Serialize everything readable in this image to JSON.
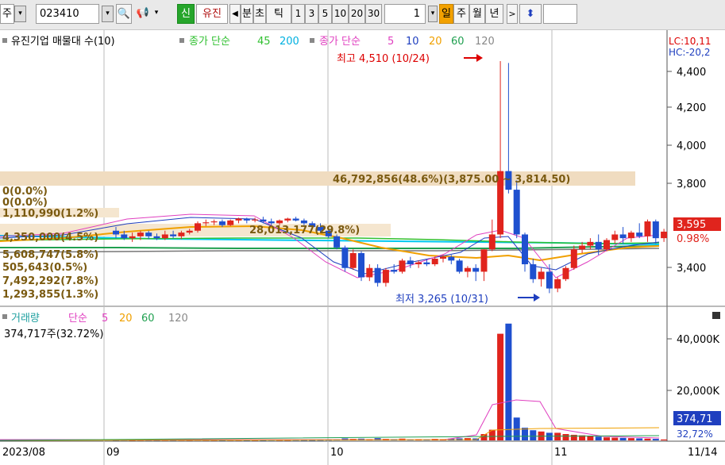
{
  "toolbar": {
    "market_label": "주",
    "code_value": "023410",
    "new_label": "신",
    "name_label": "유진",
    "period_buttons": [
      "분",
      "초",
      "틱"
    ],
    "intervals": [
      "1",
      "3",
      "5",
      "10",
      "20",
      "30"
    ],
    "interval_value": "1",
    "day_label": "일",
    "week_label": "주",
    "month_label": "월",
    "year_label": "년"
  },
  "legend": {
    "main_title": "유진기업 매물대 수(10)",
    "ma_long_label": "종가 단순",
    "ma_long_periods": [
      "45",
      "200"
    ],
    "ma_short_label": "종가 단순",
    "ma_short_periods": [
      "5",
      "10",
      "20",
      "60",
      "120"
    ],
    "lc_label": "LC:10,11",
    "hc_label": "HC:-20,2",
    "volume_label": "거래량",
    "vol_ma_label": "단순",
    "vol_ma_periods": [
      "5",
      "20",
      "60",
      "120"
    ],
    "vol_info": "374,717주(32.72%)"
  },
  "annotations": {
    "high_label": "최고 4,510 (10/24)",
    "low_label": "최저 3,265 (10/31)",
    "vp_top_label": "46,792,856(48.6%)(3,875.00 ~ 3,814.50)",
    "vp_mid_label": "28,013,177(29.8%)",
    "vp_left_labels": [
      "0(0.0%)",
      "0(0.0%)",
      "1,110,990(1.2%)",
      "4,350,000(4.5%)",
      "5,608,747(5.8%)",
      "505,643(0.5%)",
      "7,492,292(7.8%)",
      "1,293,855(1.3%)"
    ]
  },
  "axes": {
    "price_ticks": [
      "4,400",
      "4,200",
      "4,000",
      "3,800",
      "3,600",
      "3,400"
    ],
    "current_price": "3,595",
    "current_change": "0.98%",
    "volume_ticks": [
      "40,000K",
      "20,000K"
    ],
    "current_volume": "374,71",
    "current_vol_pct": "32,72%",
    "date_labels": [
      "2023/08",
      "09",
      "10",
      "11",
      "11/14"
    ]
  },
  "colors": {
    "up": "#e0241d",
    "down": "#1f50cf",
    "ma5": "#e040c0",
    "ma10": "#1f3fbf",
    "ma20": "#f0a000",
    "ma60": "#20a050",
    "ma120": "#888888",
    "ma45": "#30c030",
    "ma200": "#00c8f0",
    "vp_fill": "#f0dcc0",
    "vp_text": "#7a5a10"
  },
  "chart_data": {
    "type": "candlestick",
    "ylim": [
      3220,
      4540
    ],
    "candles": [
      {
        "o": 3600,
        "h": 3620,
        "l": 3560,
        "c": 3580
      },
      {
        "o": 3580,
        "h": 3600,
        "l": 3550,
        "c": 3560
      },
      {
        "o": 3560,
        "h": 3590,
        "l": 3540,
        "c": 3570
      },
      {
        "o": 3570,
        "h": 3600,
        "l": 3550,
        "c": 3590
      },
      {
        "o": 3590,
        "h": 3600,
        "l": 3555,
        "c": 3570
      },
      {
        "o": 3570,
        "h": 3585,
        "l": 3550,
        "c": 3560
      },
      {
        "o": 3560,
        "h": 3600,
        "l": 3550,
        "c": 3580
      },
      {
        "o": 3580,
        "h": 3600,
        "l": 3560,
        "c": 3570
      },
      {
        "o": 3570,
        "h": 3600,
        "l": 3555,
        "c": 3590
      },
      {
        "o": 3590,
        "h": 3610,
        "l": 3580,
        "c": 3600
      },
      {
        "o": 3600,
        "h": 3650,
        "l": 3590,
        "c": 3640
      },
      {
        "o": 3640,
        "h": 3660,
        "l": 3625,
        "c": 3645
      },
      {
        "o": 3645,
        "h": 3660,
        "l": 3630,
        "c": 3650
      },
      {
        "o": 3650,
        "h": 3660,
        "l": 3620,
        "c": 3630
      },
      {
        "o": 3630,
        "h": 3660,
        "l": 3625,
        "c": 3655
      },
      {
        "o": 3655,
        "h": 3670,
        "l": 3640,
        "c": 3665
      },
      {
        "o": 3665,
        "h": 3670,
        "l": 3640,
        "c": 3655
      },
      {
        "o": 3655,
        "h": 3670,
        "l": 3645,
        "c": 3660
      },
      {
        "o": 3660,
        "h": 3675,
        "l": 3640,
        "c": 3650
      },
      {
        "o": 3650,
        "h": 3665,
        "l": 3630,
        "c": 3640
      },
      {
        "o": 3640,
        "h": 3660,
        "l": 3630,
        "c": 3655
      },
      {
        "o": 3655,
        "h": 3670,
        "l": 3645,
        "c": 3665
      },
      {
        "o": 3665,
        "h": 3675,
        "l": 3650,
        "c": 3655
      },
      {
        "o": 3655,
        "h": 3665,
        "l": 3630,
        "c": 3640
      },
      {
        "o": 3640,
        "h": 3650,
        "l": 3610,
        "c": 3620
      },
      {
        "o": 3620,
        "h": 3640,
        "l": 3590,
        "c": 3600
      },
      {
        "o": 3600,
        "h": 3610,
        "l": 3560,
        "c": 3570
      },
      {
        "o": 3570,
        "h": 3580,
        "l": 3500,
        "c": 3510
      },
      {
        "o": 3510,
        "h": 3520,
        "l": 3380,
        "c": 3400
      },
      {
        "o": 3400,
        "h": 3500,
        "l": 3390,
        "c": 3480
      },
      {
        "o": 3480,
        "h": 3490,
        "l": 3330,
        "c": 3350
      },
      {
        "o": 3350,
        "h": 3420,
        "l": 3330,
        "c": 3400
      },
      {
        "o": 3400,
        "h": 3420,
        "l": 3300,
        "c": 3320
      },
      {
        "o": 3320,
        "h": 3400,
        "l": 3300,
        "c": 3390
      },
      {
        "o": 3390,
        "h": 3420,
        "l": 3370,
        "c": 3380
      },
      {
        "o": 3380,
        "h": 3450,
        "l": 3370,
        "c": 3440
      },
      {
        "o": 3440,
        "h": 3460,
        "l": 3400,
        "c": 3420
      },
      {
        "o": 3420,
        "h": 3440,
        "l": 3400,
        "c": 3430
      },
      {
        "o": 3430,
        "h": 3450,
        "l": 3410,
        "c": 3420
      },
      {
        "o": 3420,
        "h": 3460,
        "l": 3410,
        "c": 3450
      },
      {
        "o": 3450,
        "h": 3470,
        "l": 3430,
        "c": 3460
      },
      {
        "o": 3460,
        "h": 3470,
        "l": 3420,
        "c": 3440
      },
      {
        "o": 3440,
        "h": 3450,
        "l": 3370,
        "c": 3380
      },
      {
        "o": 3380,
        "h": 3410,
        "l": 3350,
        "c": 3400
      },
      {
        "o": 3400,
        "h": 3420,
        "l": 3330,
        "c": 3380
      },
      {
        "o": 3380,
        "h": 3500,
        "l": 3330,
        "c": 3500
      },
      {
        "o": 3500,
        "h": 3660,
        "l": 3490,
        "c": 3580
      },
      {
        "o": 3580,
        "h": 4510,
        "l": 3560,
        "c": 3920
      },
      {
        "o": 3920,
        "h": 4500,
        "l": 3800,
        "c": 3820
      },
      {
        "o": 3820,
        "h": 3870,
        "l": 3560,
        "c": 3580
      },
      {
        "o": 3580,
        "h": 3590,
        "l": 3380,
        "c": 3420
      },
      {
        "o": 3420,
        "h": 3450,
        "l": 3320,
        "c": 3340
      },
      {
        "o": 3340,
        "h": 3400,
        "l": 3300,
        "c": 3380
      },
      {
        "o": 3380,
        "h": 3420,
        "l": 3265,
        "c": 3290
      },
      {
        "o": 3290,
        "h": 3350,
        "l": 3270,
        "c": 3340
      },
      {
        "o": 3340,
        "h": 3410,
        "l": 3330,
        "c": 3400
      },
      {
        "o": 3400,
        "h": 3520,
        "l": 3390,
        "c": 3500
      },
      {
        "o": 3500,
        "h": 3540,
        "l": 3480,
        "c": 3520
      },
      {
        "o": 3520,
        "h": 3560,
        "l": 3500,
        "c": 3540
      },
      {
        "o": 3540,
        "h": 3580,
        "l": 3470,
        "c": 3500
      },
      {
        "o": 3500,
        "h": 3560,
        "l": 3490,
        "c": 3550
      },
      {
        "o": 3550,
        "h": 3600,
        "l": 3530,
        "c": 3580
      },
      {
        "o": 3580,
        "h": 3620,
        "l": 3530,
        "c": 3560
      },
      {
        "o": 3560,
        "h": 3600,
        "l": 3540,
        "c": 3590
      },
      {
        "o": 3590,
        "h": 3640,
        "l": 3560,
        "c": 3570
      },
      {
        "o": 3570,
        "h": 3660,
        "l": 3540,
        "c": 3650
      },
      {
        "o": 3650,
        "h": 3660,
        "l": 3530,
        "c": 3560
      },
      {
        "o": 3560,
        "h": 3610,
        "l": 3540,
        "c": 3595
      }
    ],
    "volumes": [
      200,
      250,
      180,
      220,
      210,
      190,
      230,
      200,
      240,
      210,
      260,
      230,
      220,
      200,
      240,
      230,
      210,
      220,
      200,
      250,
      230,
      220,
      240,
      210,
      200,
      230,
      260,
      300,
      800,
      600,
      700,
      500,
      900,
      600,
      500,
      700,
      400,
      500,
      450,
      600,
      500,
      700,
      800,
      900,
      800,
      2500,
      4200,
      42000,
      46000,
      9000,
      5000,
      4000,
      3500,
      3000,
      3000,
      2500,
      2200,
      2000,
      1800,
      1500,
      1200,
      1100,
      1000,
      900,
      800,
      700,
      600,
      374.717
    ],
    "vol_ylim": [
      0,
      50000
    ]
  }
}
